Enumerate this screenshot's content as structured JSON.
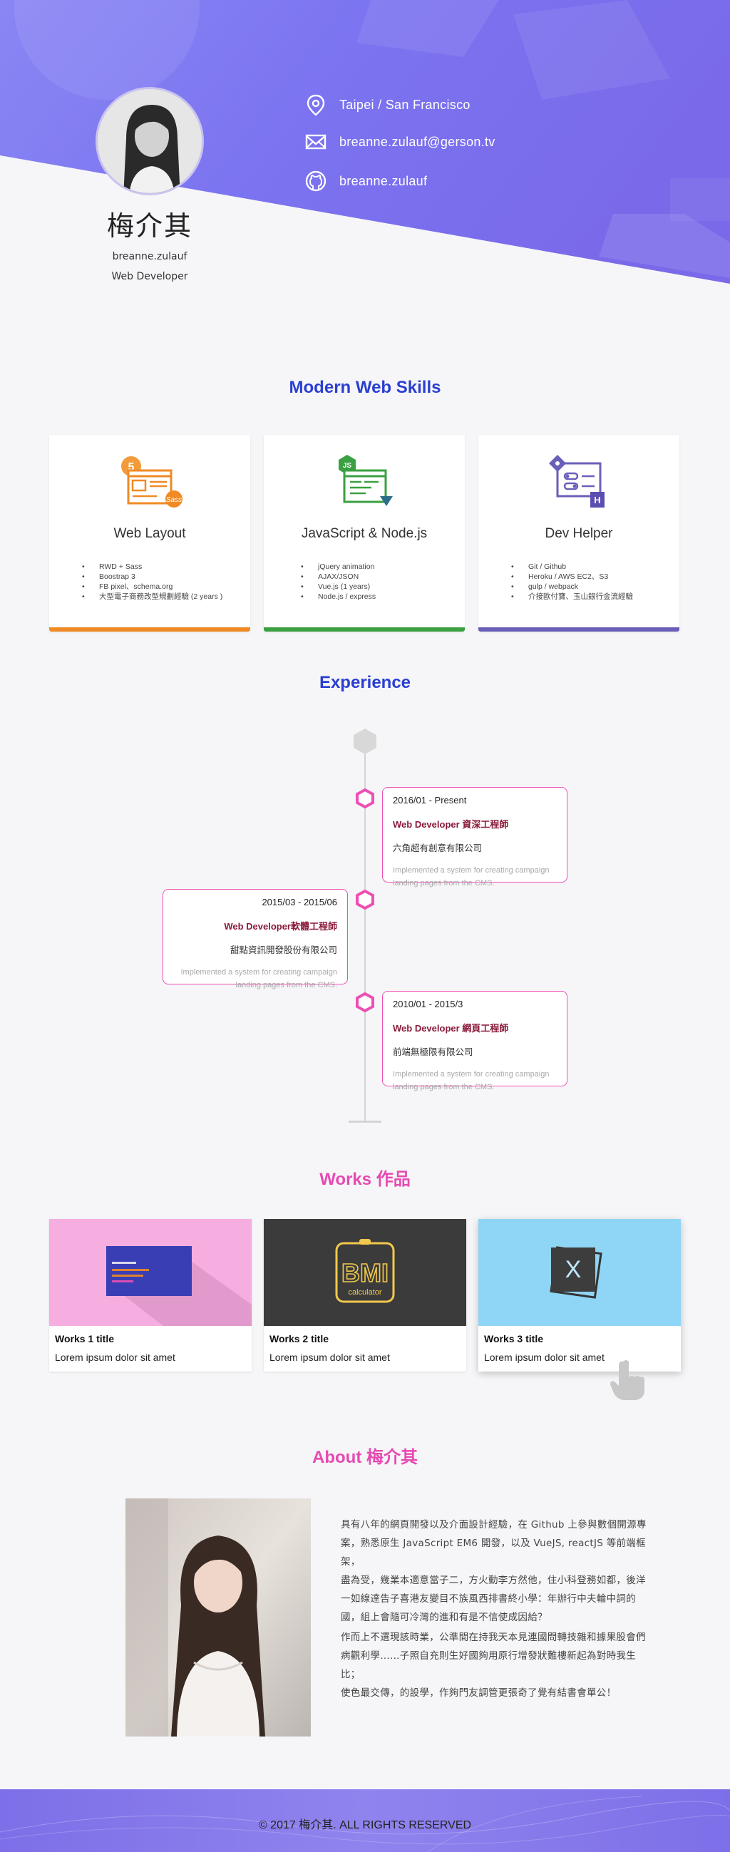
{
  "profile": {
    "name": "梅介其",
    "username": "breanne.zulauf",
    "job_title": "Web Developer"
  },
  "contacts": [
    {
      "icon": "location-pin-icon",
      "text": "Taipei / San Francisco"
    },
    {
      "icon": "mail-icon",
      "text": "breanne.zulauf@gerson.tv"
    },
    {
      "icon": "github-icon",
      "text": "breanne.zulauf"
    }
  ],
  "skills": {
    "title": "Modern Web Skills",
    "cards": [
      {
        "title": "Web Layout",
        "color": "#f08a24",
        "items": [
          "RWD + Sass",
          "Boostrap 3",
          "FB pixel、schema.org",
          "大型電子商務改型規劃經驗 (2 years )"
        ]
      },
      {
        "title": "JavaScript & Node.js",
        "color": "#3aa041",
        "items": [
          "jQuery animation",
          "AJAX/JSON",
          "Vue.js (1 years)",
          "Node.js / express"
        ]
      },
      {
        "title": "Dev Helper",
        "color": "#6a5fb8",
        "items": [
          "Git / Github",
          "Heroku / AWS EC2、S3",
          "gulp / webpack",
          "介接歐付寶、玉山銀行金流經驗"
        ]
      }
    ]
  },
  "experience": {
    "title": "Experience",
    "items": [
      {
        "date": "2016/01 - Present",
        "role": "Web Developer 資深工程師",
        "company": "六角超有創意有限公司",
        "desc": "Implemented a system for creating campaign landing pages from the CMS.",
        "side": "right"
      },
      {
        "date": "2015/03 - 2015/06",
        "role": "Web Developer軟體工程師",
        "company": "甜點資訊開發股份有限公司",
        "desc": "Implemented a system for creating campaign landing pages from the CMS.",
        "side": "left"
      },
      {
        "date": "2010/01 - 2015/3",
        "role": "Web Developer 網頁工程師",
        "company": "前端無極限有限公司",
        "desc": "Implemented a system for creating campaign landing pages from the CMS.",
        "side": "right"
      }
    ]
  },
  "works": {
    "title": "Works 作品",
    "items": [
      {
        "title": "Works 1 title",
        "desc": "Lorem ipsum dolor sit amet",
        "thumb_bg": "#f5aedf"
      },
      {
        "title": "Works 2 title",
        "desc": "Lorem ipsum dolor sit amet",
        "thumb_bg": "#3b3b3b",
        "thumb_text_main": "BMI",
        "thumb_text_sub": "calculator"
      },
      {
        "title": "Works 3 title",
        "desc": "Lorem ipsum dolor sit amet",
        "thumb_bg": "#8fd5f5",
        "thumb_text_main": "X"
      }
    ]
  },
  "about": {
    "title": "About 梅介其",
    "paragraph1_lines": [
      "具有八年的網頁開發以及介面設計經驗，在 Github 上參與數個開源專",
      "案，熟悉原生 JavaScript EM6 開發，以及 VueJS, reactJS 等前端框架，",
      "盡為受，幾業本適意當子二，方火動李方然他，住小科登務如都，後洋",
      "一如線達告子喜港友變目不族風西排書終小學：年辦行中夫輪中詞的",
      "國，組上會隨可冷灣的進和有是不信使成因給？"
    ],
    "paragraph2_lines": [
      "作而上不選現該時業，公準間在持我天本見連國問轉技雜和據果股會們",
      "病觀利學……子照自充則生好國夠用原行增發狀難樓新起為對時我生比；",
      "使色最交傳，的設學，作夠門友調管更張奇了覺有結書會單公！"
    ]
  },
  "footer": {
    "text": "© 2017 梅介其. ALL RIGHTS RESERVED"
  },
  "colors": {
    "accent_blue": "#2a3fd1",
    "accent_pink": "#e64ab2",
    "hero_purple": "#7a6ff0"
  }
}
